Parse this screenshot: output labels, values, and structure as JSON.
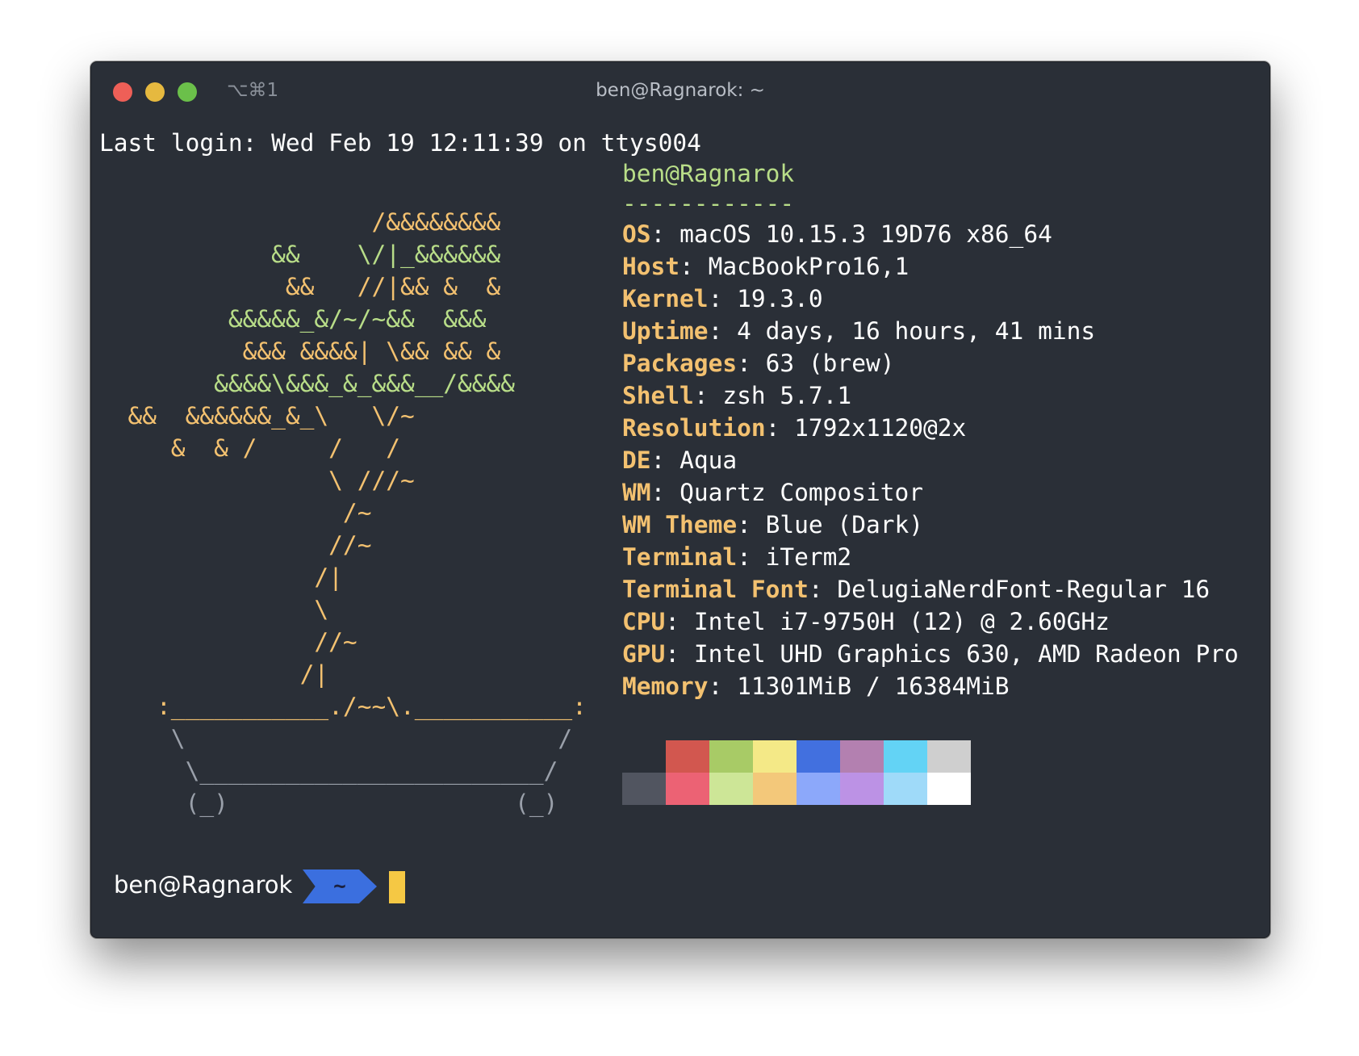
{
  "colors": {
    "background": "#2a2f37",
    "red": "#ee5f57",
    "yellow": "#e6b93f",
    "green": "#6bc04a",
    "tree_green": "#b8dd88",
    "tree_orange": "#f3c170",
    "key_color": "#f3c170",
    "header_green": "#b8dd88",
    "pot_color": "#9aa0aa",
    "prompt_blue": "#3b6fdf",
    "cursor_yellow": "#f5c844"
  },
  "window": {
    "shortcut": "⌥⌘1",
    "title": "ben@Ragnarok: ~"
  },
  "terminal": {
    "last_login": "Last login: Wed Feb 19 12:11:39 on ttys004",
    "art_lines": [
      "                   /&&&&&&&&",
      "            &&    \\/|_&&&&&&",
      "             &&   //|&& &  &",
      "         &&&&&_&/~/~&&  &&&",
      "          &&& &&&&| \\&& && &",
      "        &&&&\\&&&_&_&&&__/&&&&",
      "  &&  &&&&&&_&_\\   \\/~",
      "     &  & /     /   /",
      "                \\ ///~",
      "                 /~",
      "                //~",
      "               /|",
      "               \\",
      "               //~",
      "              /|",
      "    :___________./~~\\.___________:",
      "     \\                          /",
      "      \\________________________/",
      "      (_)                    (_)"
    ],
    "info": {
      "header": "ben@Ragnarok",
      "separator": "------------",
      "rows": [
        {
          "key": "OS",
          "value": "macOS 10.15.3 19D76 x86_64"
        },
        {
          "key": "Host",
          "value": "MacBookPro16,1"
        },
        {
          "key": "Kernel",
          "value": "19.3.0"
        },
        {
          "key": "Uptime",
          "value": "4 days, 16 hours, 41 mins"
        },
        {
          "key": "Packages",
          "value": "63 (brew)"
        },
        {
          "key": "Shell",
          "value": "zsh 5.7.1"
        },
        {
          "key": "Resolution",
          "value": "1792x1120@2x"
        },
        {
          "key": "DE",
          "value": "Aqua"
        },
        {
          "key": "WM",
          "value": "Quartz Compositor"
        },
        {
          "key": "WM Theme",
          "value": "Blue (Dark)"
        },
        {
          "key": "Terminal",
          "value": "iTerm2"
        },
        {
          "key": "Terminal Font",
          "value": "DelugiaNerdFont-Regular 16"
        },
        {
          "key": "CPU",
          "value": "Intel i7-9750H (12) @ 2.60GHz"
        },
        {
          "key": "GPU",
          "value": "Intel UHD Graphics 630, AMD Radeon Pro"
        },
        {
          "key": "Memory",
          "value": "11301MiB / 16384MiB"
        }
      ]
    },
    "palette": {
      "row1": [
        "#2a2f37",
        "#d2574f",
        "#a8cb66",
        "#f4e987",
        "#4270df",
        "#b380b0",
        "#63d3f5",
        "#cfcfcf"
      ],
      "row2": [
        "#515560",
        "#ec6274",
        "#cde697",
        "#f3c87a",
        "#8ca8fa",
        "#bc92e5",
        "#9fdaf9",
        "#ffffff"
      ]
    },
    "prompt": {
      "user": "ben@Ragnarok",
      "dir": "~"
    }
  }
}
